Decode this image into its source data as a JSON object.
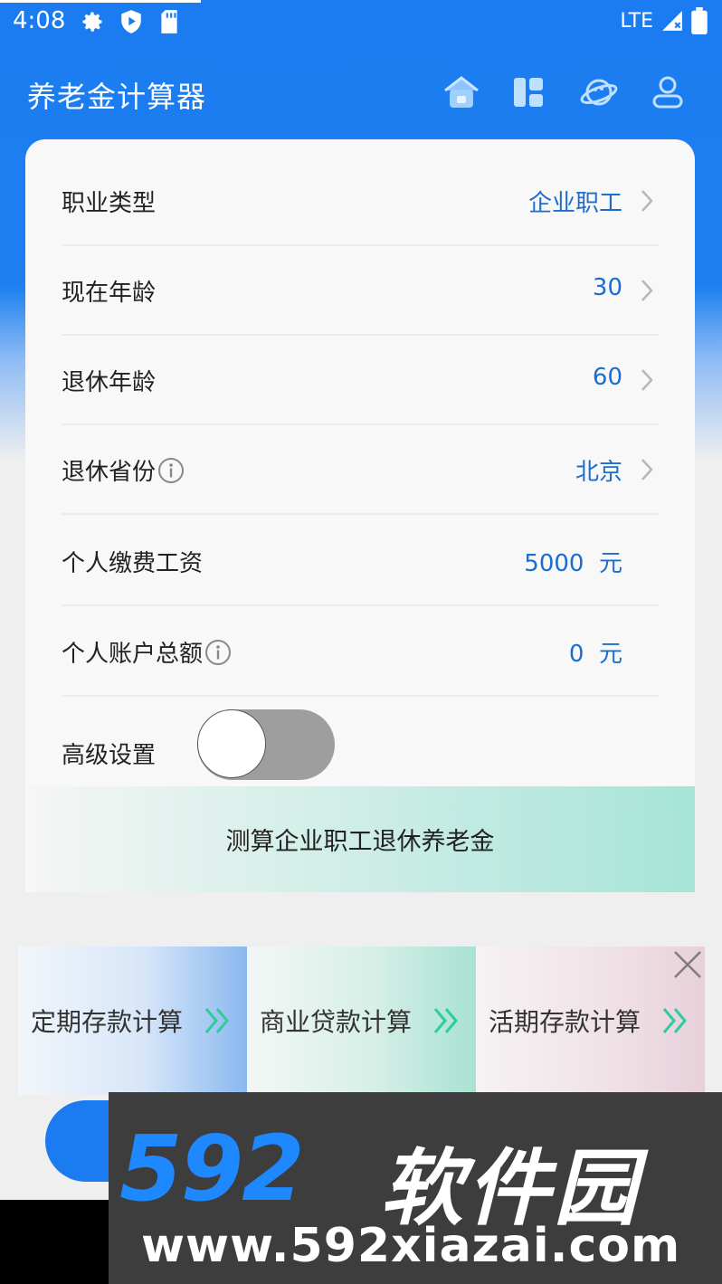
{
  "status_bar": {
    "time": "4:08",
    "network": "LTE"
  },
  "app_bar": {
    "title": "养老金计算器",
    "nav_icons": [
      "home-icon",
      "dashboard-icon",
      "planet-icon",
      "user-icon"
    ]
  },
  "form": {
    "rows": [
      {
        "label": "职业类型",
        "value": "企业职工"
      },
      {
        "label": "现在年龄",
        "value": "30"
      },
      {
        "label": "退休年龄",
        "value": "60"
      },
      {
        "label": "退休省份",
        "value": "北京"
      },
      {
        "label": "个人缴费工资",
        "value": "5000  元"
      },
      {
        "label": "个人账户总额",
        "value": "0  元"
      }
    ],
    "advanced_label": "高级设置",
    "advanced_enabled": false,
    "submit_label": "测算企业职工退休养老金"
  },
  "banner": {
    "tiles": [
      {
        "label": "定期存款计算"
      },
      {
        "label": "商业贷款计算"
      },
      {
        "label": "活期存款计算"
      }
    ]
  },
  "watermark": {
    "brand_num": "592",
    "brand_cn": "软件园",
    "url": "www.592xiazai.com"
  },
  "colors": {
    "primary": "#1a7cf0",
    "value_text": "#1c6dd0",
    "accent_green": "#2ecc9a"
  }
}
